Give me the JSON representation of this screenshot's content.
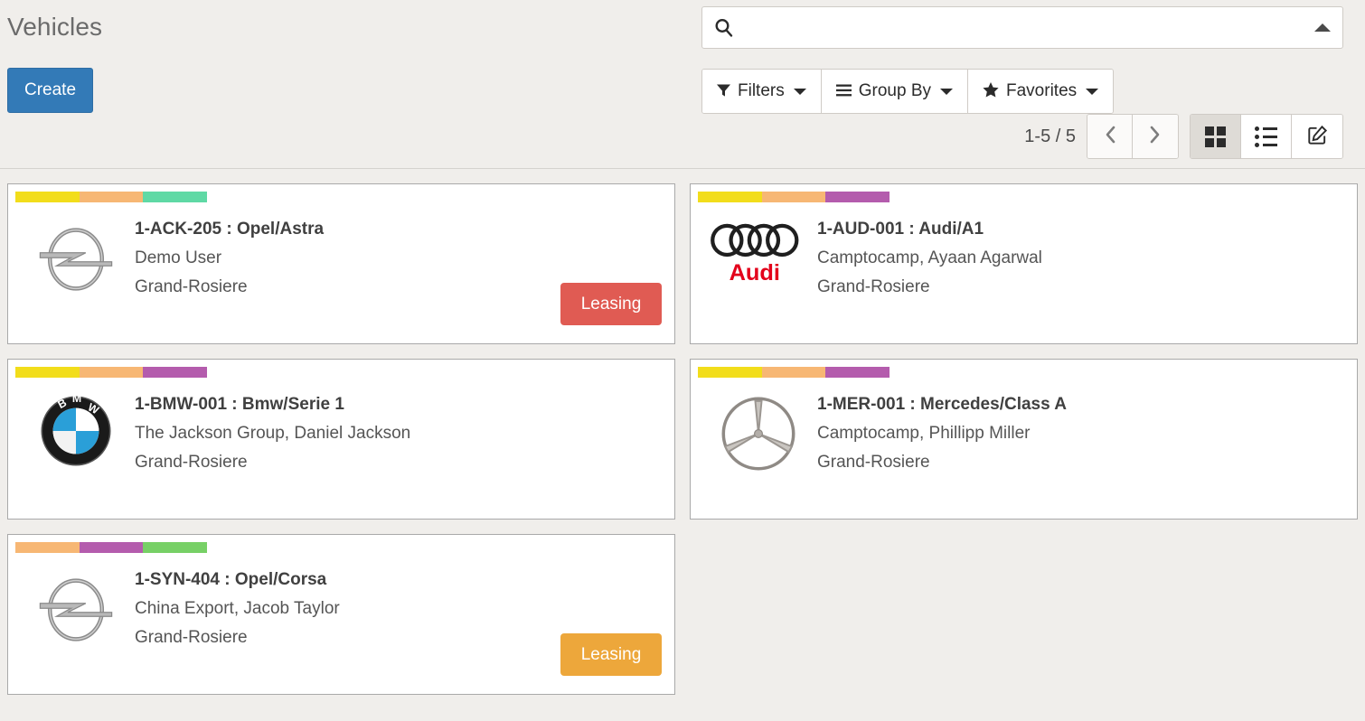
{
  "header": {
    "title": "Vehicles",
    "create_label": "Create"
  },
  "search": {
    "value": "",
    "placeholder": "",
    "icon": "search-icon",
    "toggle_icon": "caret-up-icon"
  },
  "filter_bar": {
    "buttons": [
      {
        "label": "Filters",
        "icon": "funnel-icon"
      },
      {
        "label": "Group By",
        "icon": "hamburger-icon"
      },
      {
        "label": "Favorites",
        "icon": "star-icon"
      }
    ]
  },
  "pager": {
    "count_label": "1-5 / 5",
    "previous_icon": "chevron-left-icon",
    "next_icon": "chevron-right-icon"
  },
  "view_switcher": {
    "views": [
      {
        "name": "kanban",
        "icon": "grid-icon",
        "active": true
      },
      {
        "name": "list",
        "icon": "list-icon",
        "active": false
      },
      {
        "name": "form",
        "icon": "pencil-square-icon",
        "active": false
      }
    ]
  },
  "colors": {
    "accent_blue": "#337ab7",
    "stripe_yellow": "#f2dd1b",
    "stripe_orange": "#f7b774",
    "stripe_green": "#5fd9a5",
    "stripe_purple": "#b45cad",
    "stripe_lightgreen": "#77d066",
    "badge_red": "#e05b53",
    "badge_orange": "#eda73b",
    "audi_red": "#e3001b",
    "bmw_blue": "#2a9fd8"
  },
  "cards": [
    {
      "logo": "opel-logo",
      "stripes": [
        "#f2dd1b",
        "#f7b774",
        "#5fd9a5"
      ],
      "title": "1-ACK-205 : Opel/Astra",
      "driver": "Demo User",
      "location": "Grand-Rosiere",
      "badge": {
        "label": "Leasing",
        "color": "#e05b53"
      }
    },
    {
      "logo": "audi-logo",
      "stripes": [
        "#f2dd1b",
        "#f7b774",
        "#b45cad"
      ],
      "title": "1-AUD-001 : Audi/A1",
      "driver": "Camptocamp, Ayaan Agarwal",
      "location": "Grand-Rosiere",
      "badge": null
    },
    {
      "logo": "bmw-logo",
      "stripes": [
        "#f2dd1b",
        "#f7b774",
        "#b45cad"
      ],
      "title": "1-BMW-001 : Bmw/Serie 1",
      "driver": "The Jackson Group, Daniel Jackson",
      "location": "Grand-Rosiere",
      "badge": null
    },
    {
      "logo": "mercedes-logo",
      "stripes": [
        "#f2dd1b",
        "#f7b774",
        "#b45cad"
      ],
      "title": "1-MER-001 : Mercedes/Class A",
      "driver": "Camptocamp, Phillipp Miller",
      "location": "Grand-Rosiere",
      "badge": null
    },
    {
      "logo": "opel-logo",
      "stripes": [
        "#f7b774",
        "#b45cad",
        "#77d066"
      ],
      "title": "1-SYN-404 : Opel/Corsa",
      "driver": "China Export, Jacob Taylor",
      "location": "Grand-Rosiere",
      "badge": {
        "label": "Leasing",
        "color": "#eda73b"
      }
    }
  ]
}
